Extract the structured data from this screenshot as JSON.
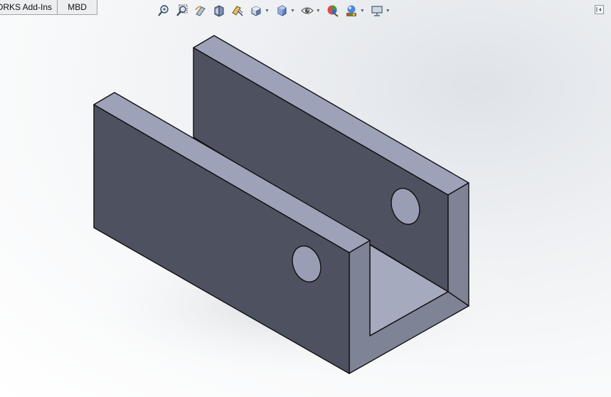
{
  "tabs": [
    {
      "label": "ORKS Add-Ins"
    },
    {
      "label": "MBD"
    }
  ],
  "toolbar": {
    "icons": [
      "zoom-to-fit-icon",
      "zoom-to-area-icon",
      "previous-view-icon",
      "section-view-icon",
      "dynamic-annotation-views-icon",
      "view-orientation-icon",
      "display-style-icon",
      "hide-show-items-icon",
      "edit-appearance-icon",
      "apply-scene-icon",
      "view-settings-icon"
    ]
  },
  "colors": {
    "face_dark": "#4e5260",
    "face_top": "#9ea2b8",
    "face_side": "#7f8396",
    "face_inner_floor": "#a6aabf",
    "edge": "#101010"
  }
}
